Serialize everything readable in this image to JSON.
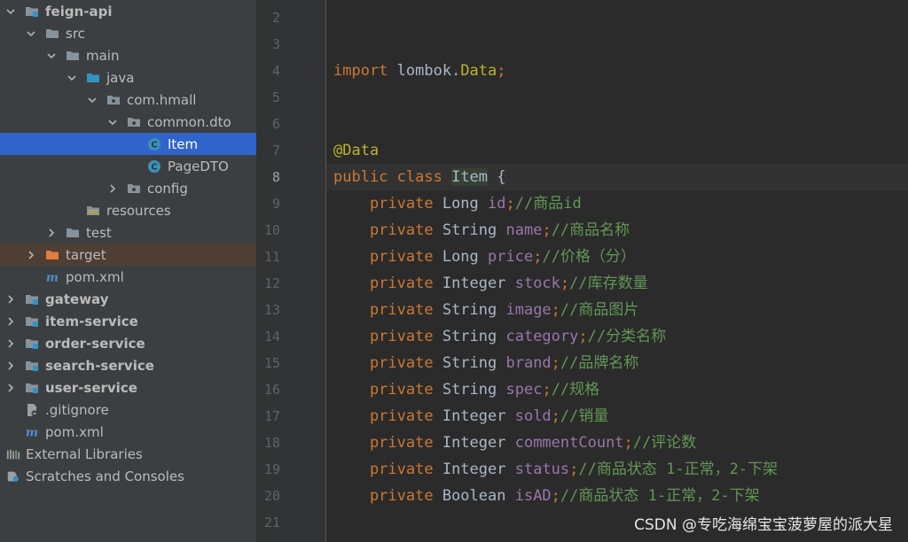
{
  "tree": [
    {
      "depth": 0,
      "arrow": "down",
      "icon": "module-folder-icon",
      "label": "feign-api",
      "bold": true
    },
    {
      "depth": 1,
      "arrow": "down",
      "icon": "folder-icon",
      "label": "src"
    },
    {
      "depth": 2,
      "arrow": "down",
      "icon": "folder-icon",
      "label": "main"
    },
    {
      "depth": 3,
      "arrow": "down",
      "icon": "source-folder-icon",
      "label": "java"
    },
    {
      "depth": 4,
      "arrow": "down",
      "icon": "package-icon",
      "label": "com.hmall"
    },
    {
      "depth": 5,
      "arrow": "down",
      "icon": "package-icon",
      "label": "common.dto"
    },
    {
      "depth": 6,
      "arrow": "none",
      "icon": "class-icon",
      "label": "Item",
      "selected": true
    },
    {
      "depth": 6,
      "arrow": "none",
      "icon": "class-icon",
      "label": "PageDTO"
    },
    {
      "depth": 5,
      "arrow": "right",
      "icon": "package-icon",
      "label": "config"
    },
    {
      "depth": 3,
      "arrow": "none",
      "icon": "resources-folder-icon",
      "label": "resources"
    },
    {
      "depth": 2,
      "arrow": "right",
      "icon": "folder-icon",
      "label": "test"
    },
    {
      "depth": 1,
      "arrow": "right",
      "icon": "excluded-folder-icon",
      "label": "target",
      "excluded": true
    },
    {
      "depth": 1,
      "arrow": "none",
      "icon": "maven-icon",
      "label": "pom.xml"
    },
    {
      "depth": 0,
      "arrow": "right",
      "icon": "module-folder-icon",
      "label": "gateway",
      "bold": true
    },
    {
      "depth": 0,
      "arrow": "right",
      "icon": "module-folder-icon",
      "label": "item-service",
      "bold": true
    },
    {
      "depth": 0,
      "arrow": "right",
      "icon": "module-folder-icon",
      "label": "order-service",
      "bold": true
    },
    {
      "depth": 0,
      "arrow": "right",
      "icon": "module-folder-icon",
      "label": "search-service",
      "bold": true
    },
    {
      "depth": 0,
      "arrow": "right",
      "icon": "module-folder-icon",
      "label": "user-service",
      "bold": true
    },
    {
      "depth": 0,
      "arrow": "none",
      "icon": "gitignore-icon",
      "label": ".gitignore"
    },
    {
      "depth": 0,
      "arrow": "none",
      "icon": "maven-icon",
      "label": "pom.xml"
    },
    {
      "depth": -1,
      "arrow": "none",
      "icon": "libraries-icon",
      "label": "External Libraries"
    },
    {
      "depth": -1,
      "arrow": "none",
      "icon": "scratches-icon",
      "label": "Scratches and Consoles"
    }
  ],
  "editor": {
    "active_line": "8",
    "lines": [
      {
        "n": "2"
      },
      {
        "n": "3"
      },
      {
        "n": "4",
        "tokens": [
          {
            "t": "import ",
            "c": "kw"
          },
          {
            "t": "lombok.",
            "c": "typ"
          },
          {
            "t": "Data",
            "c": "ann"
          },
          {
            "t": ";",
            "c": "kw"
          }
        ]
      },
      {
        "n": "5"
      },
      {
        "n": "6"
      },
      {
        "n": "7",
        "tokens": [
          {
            "t": "@Data",
            "c": "ann"
          }
        ]
      },
      {
        "n": "8",
        "tokens": [
          {
            "t": "public ",
            "c": "kw"
          },
          {
            "t": "class ",
            "c": "kw"
          },
          {
            "t": "Item",
            "c": "typ",
            "hl": true
          },
          {
            "t": " {",
            "c": "typ"
          }
        ]
      },
      {
        "n": "9",
        "tokens": [
          {
            "t": "    private ",
            "c": "kw"
          },
          {
            "t": "Long ",
            "c": "typ"
          },
          {
            "t": "id",
            "c": "fld"
          },
          {
            "t": ";",
            "c": "kw"
          },
          {
            "t": "//商品id",
            "c": "cmt"
          }
        ]
      },
      {
        "n": "10",
        "tokens": [
          {
            "t": "    private ",
            "c": "kw"
          },
          {
            "t": "String ",
            "c": "typ"
          },
          {
            "t": "name",
            "c": "fld"
          },
          {
            "t": ";",
            "c": "kw"
          },
          {
            "t": "//商品名称",
            "c": "cmt"
          }
        ]
      },
      {
        "n": "11",
        "tokens": [
          {
            "t": "    private ",
            "c": "kw"
          },
          {
            "t": "Long ",
            "c": "typ"
          },
          {
            "t": "price",
            "c": "fld"
          },
          {
            "t": ";",
            "c": "kw"
          },
          {
            "t": "//价格（分）",
            "c": "cmt"
          }
        ]
      },
      {
        "n": "12",
        "tokens": [
          {
            "t": "    private ",
            "c": "kw"
          },
          {
            "t": "Integer ",
            "c": "typ"
          },
          {
            "t": "stock",
            "c": "fld"
          },
          {
            "t": ";",
            "c": "kw"
          },
          {
            "t": "//库存数量",
            "c": "cmt"
          }
        ]
      },
      {
        "n": "13",
        "tokens": [
          {
            "t": "    private ",
            "c": "kw"
          },
          {
            "t": "String ",
            "c": "typ"
          },
          {
            "t": "image",
            "c": "fld"
          },
          {
            "t": ";",
            "c": "kw"
          },
          {
            "t": "//商品图片",
            "c": "cmt"
          }
        ]
      },
      {
        "n": "14",
        "tokens": [
          {
            "t": "    private ",
            "c": "kw"
          },
          {
            "t": "String ",
            "c": "typ"
          },
          {
            "t": "category",
            "c": "fld"
          },
          {
            "t": ";",
            "c": "kw"
          },
          {
            "t": "//分类名称",
            "c": "cmt"
          }
        ]
      },
      {
        "n": "15",
        "tokens": [
          {
            "t": "    private ",
            "c": "kw"
          },
          {
            "t": "String ",
            "c": "typ"
          },
          {
            "t": "brand",
            "c": "fld"
          },
          {
            "t": ";",
            "c": "kw"
          },
          {
            "t": "//品牌名称",
            "c": "cmt"
          }
        ]
      },
      {
        "n": "16",
        "tokens": [
          {
            "t": "    private ",
            "c": "kw"
          },
          {
            "t": "String ",
            "c": "typ"
          },
          {
            "t": "spec",
            "c": "fld"
          },
          {
            "t": ";",
            "c": "kw"
          },
          {
            "t": "//规格",
            "c": "cmt"
          }
        ]
      },
      {
        "n": "17",
        "tokens": [
          {
            "t": "    private ",
            "c": "kw"
          },
          {
            "t": "Integer ",
            "c": "typ"
          },
          {
            "t": "sold",
            "c": "fld"
          },
          {
            "t": ";",
            "c": "kw"
          },
          {
            "t": "//销量",
            "c": "cmt"
          }
        ]
      },
      {
        "n": "18",
        "tokens": [
          {
            "t": "    private ",
            "c": "kw"
          },
          {
            "t": "Integer ",
            "c": "typ"
          },
          {
            "t": "commentCount",
            "c": "fld"
          },
          {
            "t": ";",
            "c": "kw"
          },
          {
            "t": "//评论数",
            "c": "cmt"
          }
        ]
      },
      {
        "n": "19",
        "tokens": [
          {
            "t": "    private ",
            "c": "kw"
          },
          {
            "t": "Integer ",
            "c": "typ"
          },
          {
            "t": "status",
            "c": "fld"
          },
          {
            "t": ";",
            "c": "kw"
          },
          {
            "t": "//商品状态 1-正常，2-下架",
            "c": "cmt"
          }
        ]
      },
      {
        "n": "20",
        "tokens": [
          {
            "t": "    private ",
            "c": "kw"
          },
          {
            "t": "Boolean ",
            "c": "typ"
          },
          {
            "t": "isAD",
            "c": "fld"
          },
          {
            "t": ";",
            "c": "kw"
          },
          {
            "t": "//商品状态 1-正常，2-下架",
            "c": "cmt"
          }
        ]
      },
      {
        "n": "21"
      }
    ]
  },
  "watermark": "CSDN @专吃海绵宝宝菠萝屋的派大星",
  "colors": {
    "keyword": "#cc7832",
    "annotation": "#bbb529",
    "field": "#9876aa",
    "comment": "#629755",
    "selection": "#2f65ca"
  }
}
